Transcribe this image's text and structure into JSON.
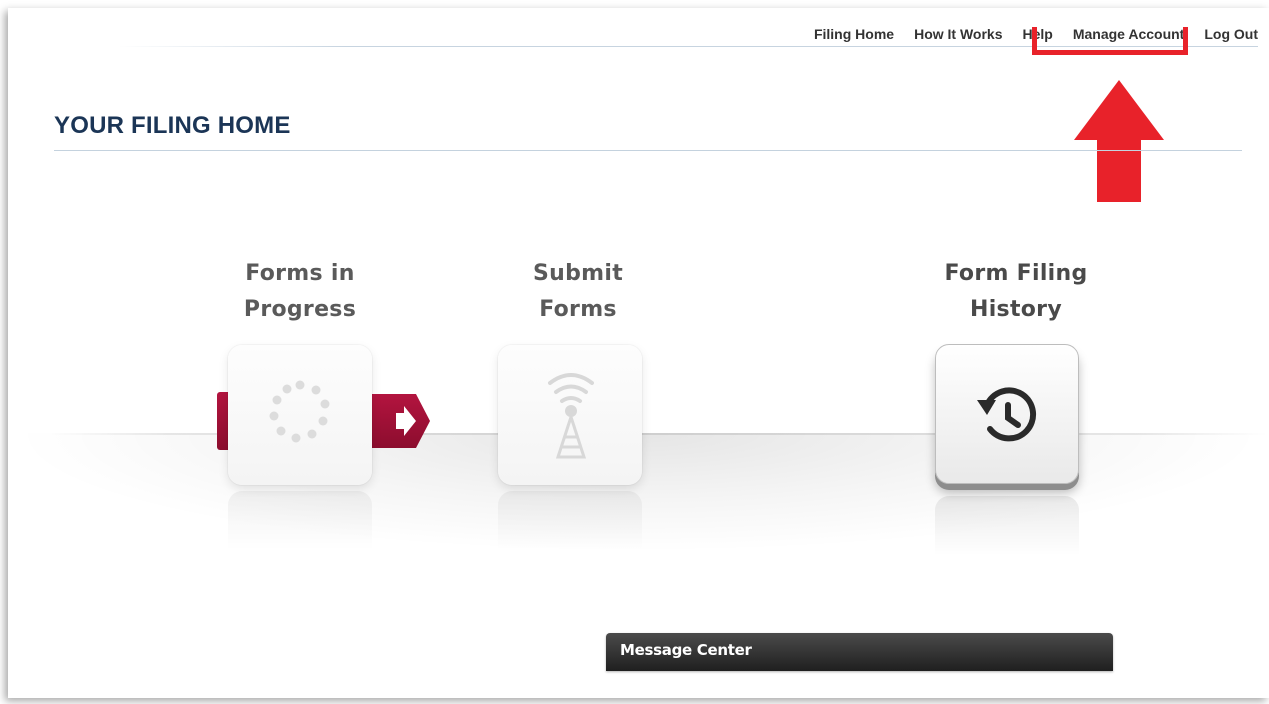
{
  "topnav": {
    "items": [
      {
        "label": "Filing Home"
      },
      {
        "label": "How It Works"
      },
      {
        "label": "Help"
      },
      {
        "label": "Manage Account"
      },
      {
        "label": "Log Out"
      }
    ]
  },
  "page": {
    "title": "YOUR FILING HOME"
  },
  "tiles": [
    {
      "label_line1": "Forms in",
      "label_line2": "Progress",
      "icon": "loading-spinner-icon",
      "state": "disabled"
    },
    {
      "label_line1": "Submit",
      "label_line2": "Forms",
      "icon": "broadcast-tower-icon",
      "state": "disabled"
    },
    {
      "label_line1": "Form Filing",
      "label_line2": "History",
      "icon": "history-clock-icon",
      "state": "active"
    }
  ],
  "annotation": {
    "highlight_color": "#e8222a",
    "arrow_icon": "red-up-arrow-icon"
  },
  "message_center": {
    "label": "Message Center"
  },
  "colors": {
    "title": "#1b3556",
    "flag": "#a01238",
    "tile_text": "#4a4a4a"
  }
}
